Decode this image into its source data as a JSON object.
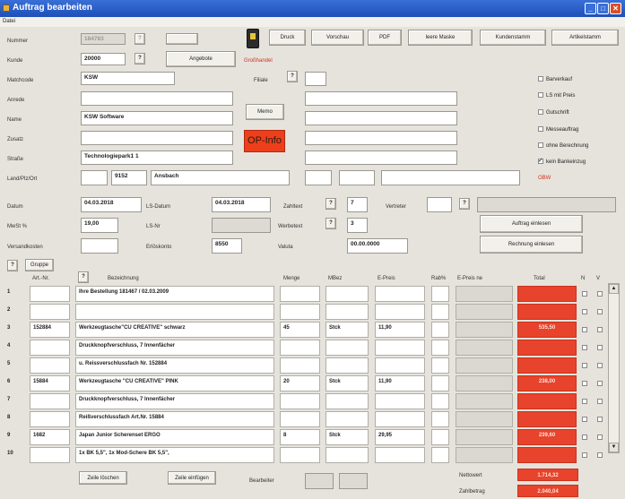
{
  "window": {
    "title": "Auftrag bearbeiten",
    "menu": "Datei"
  },
  "toolbar": {
    "druck": "Druck",
    "vorschau": "Vorschau",
    "pdf": "PDF",
    "leere_maske": "leere Maske",
    "kundenstamm": "Kundenstamm",
    "artikelstamm": "Artikelstamm"
  },
  "labels": {
    "nummer": "Nummer",
    "kunde": "Kunde",
    "matchcode": "Matchcode",
    "anrede": "Anrede",
    "name": "Name",
    "zusatz": "Zusatz",
    "strasse": "Straße",
    "land": "Land/Plz/Ort",
    "filiale": "Filiale",
    "datum": "Datum",
    "ls_datum": "LS-Datum",
    "zahltext": "Zahltext",
    "vertreter": "Vertreter",
    "mwst": "MwSt %",
    "ls_nr": "LS-Nr",
    "werbetext": "Werbetext",
    "versandkosten": "Versandkosten",
    "erloeskonto": "Erlöskonto",
    "valuta": "Valuta",
    "bearbeiter": "Bearbeiter",
    "nettowert": "Nettowert",
    "zahlbetrag": "Zahlbetrag",
    "grosshandel": "Großhandel",
    "obw": "OBW"
  },
  "buttons": {
    "q": "?",
    "angebote": "Angebote",
    "memo": "Memo",
    "opinfo": "OP-Info",
    "auftrag_einlesen": "Auftrag einlesen",
    "rechnung_einlesen": "Rechnung einlesen",
    "gruppe": "Gruppe",
    "zeile_loeschen": "Zeile löschen",
    "zeile_einfuegen": "Zeile einfügen"
  },
  "fields": {
    "nummer": "184783",
    "kunde": "20000",
    "matchcode": "KSW",
    "name": "KSW Software",
    "strasse": "Technologiepark1 1",
    "plz": "9152",
    "ort": "Ansbach",
    "datum": "04.03.2018",
    "ls_datum": "04.03.2018",
    "zahltext": "7",
    "mwst": "19,00",
    "werbetext": "3",
    "erloeskonto": "8550",
    "valuta": "00.00.0000"
  },
  "checkboxes": [
    {
      "label": "Barverkauf",
      "checked": false
    },
    {
      "label": "LS mit Preis",
      "checked": false
    },
    {
      "label": "Gutschrift",
      "checked": false
    },
    {
      "label": "Messeauftrag",
      "checked": false
    },
    {
      "label": "ohne Berechnung",
      "checked": false
    },
    {
      "label": "kein Bankeinzug",
      "checked": true
    }
  ],
  "grid": {
    "headers": {
      "art_nr": "Art.-Nr.",
      "bezeichnung": "Bezeichnung",
      "menge": "Menge",
      "mbez": "MBez",
      "epreis": "E-Preis",
      "rab": "Rab%",
      "epreis_ne": "E-Preis ne",
      "total": "Total",
      "n": "N",
      "v": "V"
    },
    "rows": [
      {
        "num": "1",
        "art": "",
        "bez": "Ihre Bestellung 181467 / 02.03.2009",
        "menge": "",
        "mbez": "",
        "preis": "",
        "total": ""
      },
      {
        "num": "2",
        "art": "",
        "bez": "",
        "menge": "",
        "mbez": "",
        "preis": "",
        "total": ""
      },
      {
        "num": "3",
        "art": "152884",
        "bez": "Werkzeugtasche\"CU CREATIVE\" schwarz",
        "menge": "45",
        "mbez": "Stck",
        "preis": "11,90",
        "total": "535,50"
      },
      {
        "num": "4",
        "art": "",
        "bez": "Druckknopfverschluss, 7 Innenfächer",
        "menge": "",
        "mbez": "",
        "preis": "",
        "total": ""
      },
      {
        "num": "5",
        "art": "",
        "bez": "u. Reissverschlussfach  Nr. 152884",
        "menge": "",
        "mbez": "",
        "preis": "",
        "total": ""
      },
      {
        "num": "6",
        "art": "15884",
        "bez": "Werkzeugtasche \"CU CREATIVE\" PINK",
        "menge": "20",
        "mbez": "Stck",
        "preis": "11,90",
        "total": "238,00"
      },
      {
        "num": "7",
        "art": "",
        "bez": "Druckknopfverschluss, 7 Innenfächer",
        "menge": "",
        "mbez": "",
        "preis": "",
        "total": ""
      },
      {
        "num": "8",
        "art": "",
        "bez": "Reißverschlussfach  Art.Nr. 15884",
        "menge": "",
        "mbez": "",
        "preis": "",
        "total": ""
      },
      {
        "num": "9",
        "art": "1682",
        "bez": "Japan Junior Scherenset ERGO",
        "menge": "8",
        "mbez": "Stck",
        "preis": "29,95",
        "total": "239,60"
      },
      {
        "num": "10",
        "art": "",
        "bez": "1x BK 5,5\", 1x Mod-Schere BK 5,5\",",
        "menge": "",
        "mbez": "",
        "preis": "",
        "total": ""
      }
    ]
  },
  "totals": {
    "nettowert": "1.714,32",
    "zahlbetrag": "2.040,04"
  },
  "colors": {
    "titlebar": "#2457c5",
    "total_red": "#e8432c",
    "accent_red": "#d23020"
  }
}
